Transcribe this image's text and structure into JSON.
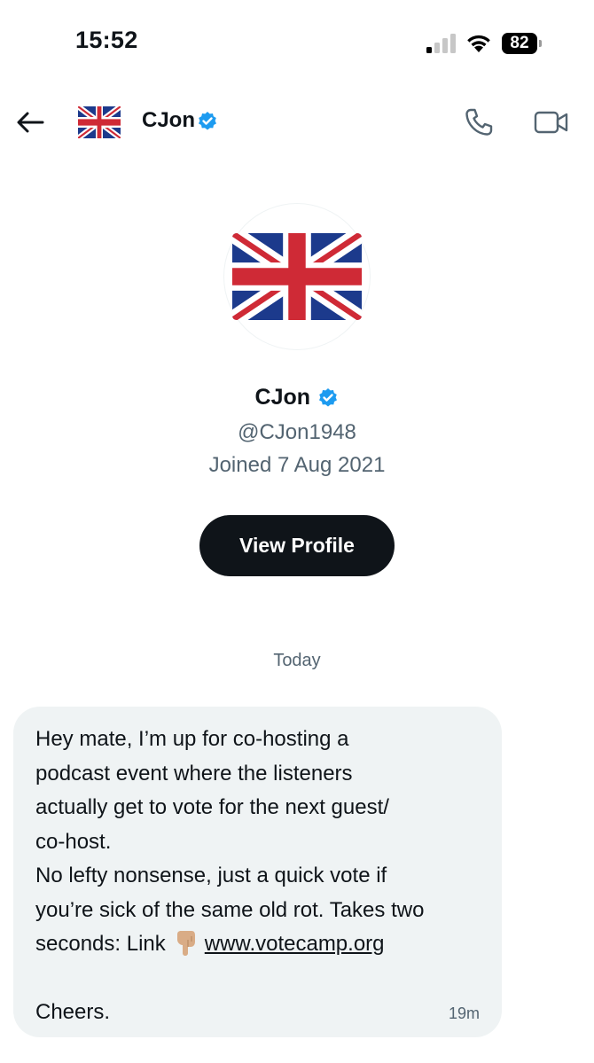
{
  "status_bar": {
    "time": "15:52",
    "battery": "82"
  },
  "header": {
    "name": "CJon",
    "icons": [
      "back-arrow-icon",
      "union-jack-avatar",
      "verified-badge-icon",
      "phone-icon",
      "video-camera-icon"
    ]
  },
  "profile": {
    "name": "CJon",
    "handle": "@CJon1948",
    "joined": "Joined 7 Aug 2021",
    "view_profile_label": "View Profile"
  },
  "conversation": {
    "day_label": "Today",
    "message": {
      "lines": [
        "Hey mate, I’m up for co-hosting a",
        "podcast event where the listeners",
        "actually get to vote for the next guest/",
        "co-host.",
        "No lefty nonsense, just a quick vote if",
        "you’re sick of the same old rot. Takes two"
      ],
      "last_line_prefix": "seconds: Link",
      "link_text": "www.votecamp.org",
      "closing": "Cheers.",
      "time": "19m"
    }
  },
  "colors": {
    "text": "#0f1419",
    "secondary_text": "#536471",
    "bubble": "#eff3f4",
    "verified": "#1d9bf0",
    "button": "#0f1419"
  }
}
